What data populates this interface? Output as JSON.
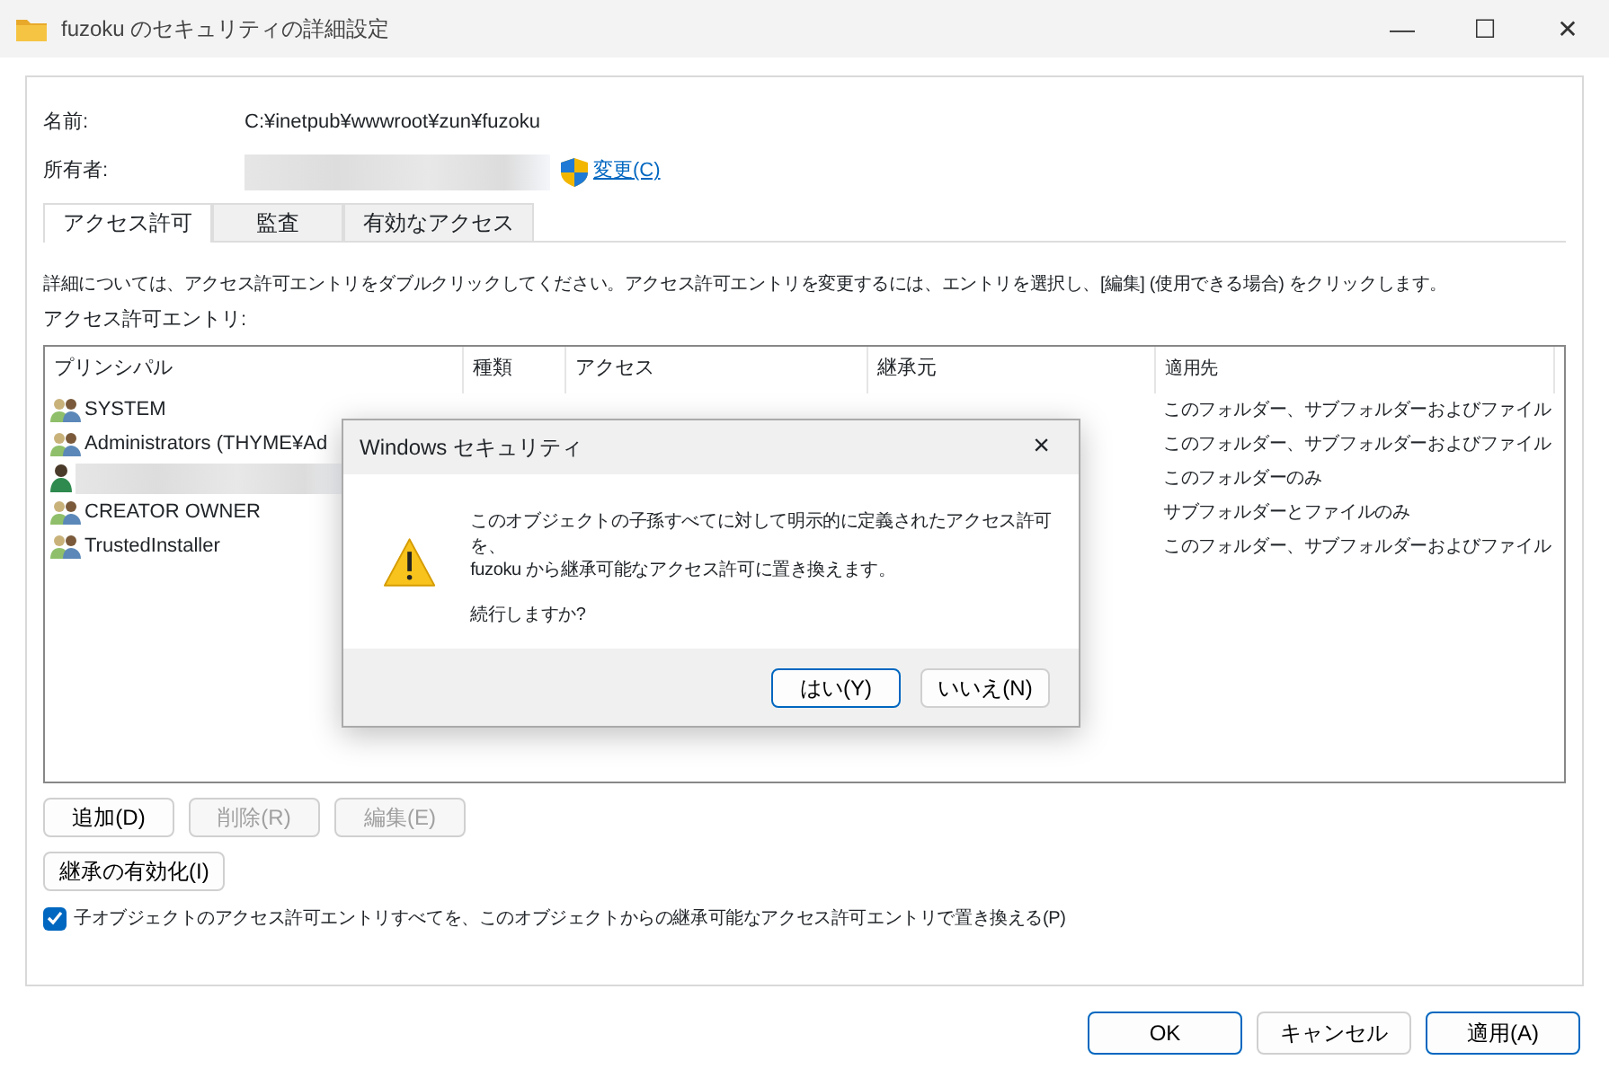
{
  "window": {
    "title": "fuzoku のセキュリティの詳細設定",
    "controls": [
      "—",
      "☐",
      "✕"
    ]
  },
  "name": {
    "label": "名前:",
    "value": "C:¥inetpub¥wwwroot¥zun¥fuzoku"
  },
  "owner": {
    "label": "所有者:",
    "change_link": "変更(C)"
  },
  "tabs": [
    {
      "label": "アクセス許可",
      "selected": true
    },
    {
      "label": "監査",
      "selected": false
    },
    {
      "label": "有効なアクセス",
      "selected": false
    }
  ],
  "description": "詳細については、アクセス許可エントリをダブルクリックしてください。アクセス許可エントリを変更するには、エントリを選択し、[編集] (使用できる場合) をクリックします。",
  "entries_label": "アクセス許可エントリ:",
  "table": {
    "columns": [
      "プリンシパル",
      "種類",
      "アクセス",
      "継承元",
      "適用先"
    ],
    "rows": [
      {
        "kind": "group",
        "principal": "SYSTEM",
        "applies_to": "このフォルダー、サブフォルダーおよびファイル"
      },
      {
        "kind": "group",
        "principal": "Administrators (THYME¥Ad",
        "applies_to": "このフォルダー、サブフォルダーおよびファイル"
      },
      {
        "kind": "user",
        "applies_to": "このフォルダーのみ"
      },
      {
        "kind": "group",
        "principal": "CREATOR OWNER",
        "applies_to": "サブフォルダーとファイルのみ"
      },
      {
        "kind": "group",
        "principal": "TrustedInstaller",
        "applies_to": "このフォルダー、サブフォルダーおよびファイル"
      }
    ]
  },
  "entry_buttons": [
    {
      "label": "追加(D)",
      "disabled": false
    },
    {
      "label": "削除(R)",
      "disabled": true
    },
    {
      "label": "編集(E)",
      "disabled": true
    }
  ],
  "inheritance_button": "継承の有効化(I)",
  "replace_checkbox": {
    "label": "子オブジェクトのアクセス許可エントリすべてを、このオブジェクトからの継承可能なアクセス許可エントリで置き換える(P)",
    "checked": true
  },
  "footer_buttons": [
    {
      "label": "OK",
      "default": true
    },
    {
      "label": "キャンセル",
      "default": false
    },
    {
      "label": "適用(A)",
      "default": true
    }
  ],
  "dialog": {
    "title": "Windows セキュリティ",
    "close": "×",
    "message": "このオブジェクトの子孫すべてに対して明示的に定義されたアクセス許可を、\nfuzoku から継承可能なアクセス許可に置き換えます。",
    "question": "続行しますか?",
    "buttons": [
      {
        "label": "はい(Y)",
        "default": true
      },
      {
        "label": "いいえ(N)",
        "default": false
      }
    ]
  }
}
